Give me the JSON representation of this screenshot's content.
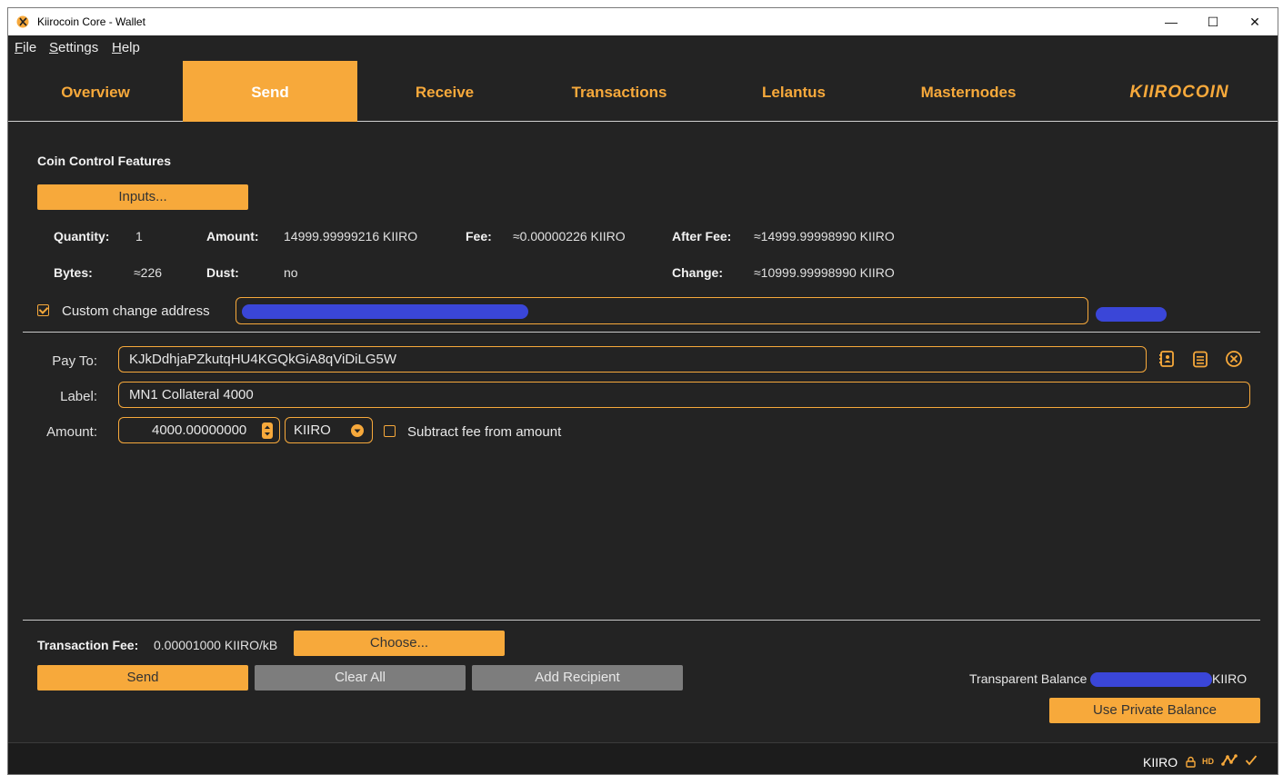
{
  "window": {
    "title": "Kiirocoin Core - Wallet"
  },
  "menu": {
    "items": [
      {
        "accel": "F",
        "rest": "ile"
      },
      {
        "accel": "S",
        "rest": "ettings"
      },
      {
        "accel": "H",
        "rest": "elp"
      }
    ]
  },
  "tabs": [
    "Overview",
    "Send",
    "Receive",
    "Transactions",
    "Lelantus",
    "Masternodes"
  ],
  "active_tab": "Send",
  "brand": "KIIROCOIN",
  "coin_control": {
    "title": "Coin Control Features",
    "inputs_button": "Inputs...",
    "quantity_label": "Quantity:",
    "quantity": "1",
    "amount_label": "Amount:",
    "amount": "14999.99999216 KIIRO",
    "fee_label": "Fee:",
    "fee": "≈0.00000226 KIIRO",
    "after_fee_label": "After Fee:",
    "after_fee": "≈14999.99998990 KIIRO",
    "bytes_label": "Bytes:",
    "bytes": "≈226",
    "dust_label": "Dust:",
    "dust": "no",
    "change_label": "Change:",
    "change": "≈10999.99998990 KIIRO",
    "custom_change_label": "Custom change address",
    "custom_change_checked": true
  },
  "recipient": {
    "pay_to_label": "Pay To:",
    "pay_to": "KJkDdhjaPZkutqHU4KGQkGiA8qViDiLG5W",
    "label_label": "Label:",
    "label": "MN1 Collateral 4000",
    "amount_label": "Amount:",
    "amount": "4000.00000000",
    "unit": "KIIRO",
    "subtract_fee_label": "Subtract fee from amount",
    "subtract_fee_checked": false
  },
  "footer": {
    "tx_fee_label": "Transaction Fee:",
    "tx_fee": "0.00001000 KIIRO/kB",
    "choose_button": "Choose...",
    "send_button": "Send",
    "clear_button": "Clear All",
    "add_recipient_button": "Add Recipient",
    "balance_label": "Transparent Balance",
    "balance_unit": "KIIRO",
    "private_balance_button": "Use Private Balance"
  },
  "status": {
    "unit": "KIIRO",
    "hd": "HD"
  },
  "colors": {
    "accent": "#f7a93b",
    "background": "#232323",
    "redaction": "#3a46d8",
    "gray_button": "#7d7d7d"
  }
}
